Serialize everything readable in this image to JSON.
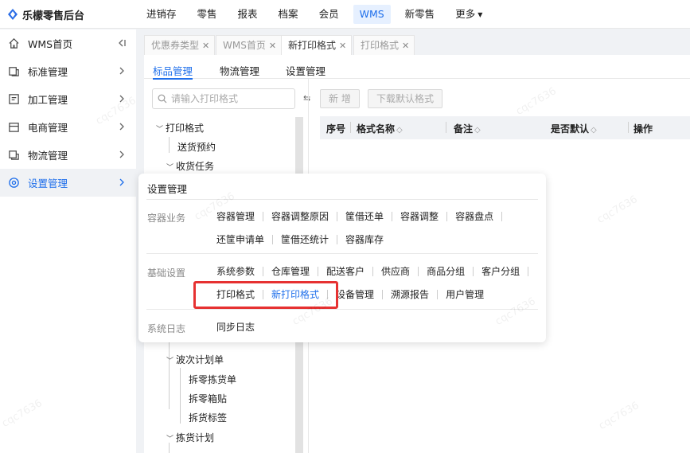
{
  "app": {
    "title": "乐檬零售后台"
  },
  "topnav": [
    {
      "label": "进销存"
    },
    {
      "label": "零售"
    },
    {
      "label": "报表"
    },
    {
      "label": "档案"
    },
    {
      "label": "会员"
    },
    {
      "label": "WMS",
      "active": true
    },
    {
      "label": "新零售"
    },
    {
      "label": "更多"
    }
  ],
  "sidebar": [
    {
      "label": "WMS首页",
      "icon": "home-icon"
    },
    {
      "label": "标准管理",
      "icon": "standard-icon"
    },
    {
      "label": "加工管理",
      "icon": "process-icon"
    },
    {
      "label": "电商管理",
      "icon": "store-icon"
    },
    {
      "label": "物流管理",
      "icon": "box-icon"
    },
    {
      "label": "设置管理",
      "icon": "settings-icon",
      "active": true
    }
  ],
  "tabs": [
    {
      "label": "优惠券类型"
    },
    {
      "label": "WMS首页"
    },
    {
      "label": "新打印格式",
      "active": true
    },
    {
      "label": "打印格式"
    }
  ],
  "subtabs": [
    {
      "label": "标品管理",
      "active": true
    },
    {
      "label": "物流管理"
    },
    {
      "label": "设置管理"
    }
  ],
  "search": {
    "placeholder": "请输入打印格式"
  },
  "collapse": "⇆",
  "tree": [
    {
      "label": "打印格式"
    },
    {
      "label": "送货预约"
    },
    {
      "label": "收货任务"
    },
    {
      "label": "波次计划单"
    },
    {
      "label": "拆零拣货单"
    },
    {
      "label": "拆零箱贴"
    },
    {
      "label": "拆货标签"
    },
    {
      "label": "拣货计划"
    }
  ],
  "toolbar": {
    "add": "新 增",
    "download": "下载默认格式"
  },
  "table": {
    "headers": [
      "序号",
      "格式名称",
      "备注",
      "是否默认",
      "操作"
    ]
  },
  "popup": {
    "title": "设置管理",
    "groups": [
      {
        "label": "容器业务",
        "rows": [
          [
            "容器管理",
            "容器调整原因",
            "筐借还单",
            "容器调整",
            "容器盘点"
          ],
          [
            "还筐申请单",
            "筐借还统计",
            "容器库存"
          ]
        ]
      },
      {
        "label": "基础设置",
        "rows": [
          [
            "系统参数",
            "仓库管理",
            "配送客户",
            "供应商",
            "商品分组",
            "客户分组"
          ],
          [
            "打印格式",
            "新打印格式",
            "设备管理",
            "溯源报告",
            "用户管理"
          ]
        ]
      },
      {
        "label": "系统日志",
        "rows": [
          [
            "同步日志"
          ]
        ]
      }
    ]
  },
  "watermark": "cqc7636",
  "colors": {
    "accent": "#1f6feb",
    "highlight_box": "#e63131"
  }
}
